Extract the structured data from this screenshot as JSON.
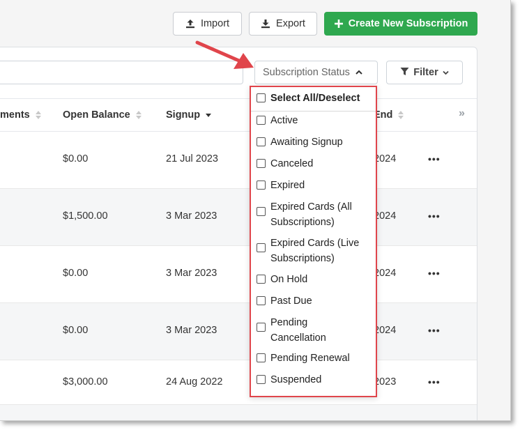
{
  "toolbar": {
    "import_label": "Import",
    "export_label": "Export",
    "create_label": "Create New Subscription"
  },
  "filters": {
    "search_value": "",
    "status_label": "Subscription Status",
    "filter_label": "Filter"
  },
  "table": {
    "columns": [
      {
        "label": "ments"
      },
      {
        "label": "Open Balance"
      },
      {
        "label": "Signup"
      },
      {
        "label": "End"
      }
    ],
    "rows": [
      {
        "open_balance": "$0.00",
        "signup": "21 Jul 2023",
        "end": "2024",
        "more": "•••"
      },
      {
        "open_balance": "$1,500.00",
        "signup": "3 Mar 2023",
        "end": "2024",
        "more": "•••"
      },
      {
        "open_balance": "$0.00",
        "signup": "3 Mar 2023",
        "end": "2024",
        "more": "•••"
      },
      {
        "open_balance": "$0.00",
        "signup": "3 Mar 2023",
        "end": "2024",
        "more": "•••"
      },
      {
        "open_balance": "$3,000.00",
        "signup": "24 Aug 2022",
        "end": "2023",
        "more": "•••"
      }
    ],
    "expand_glyph": "»"
  },
  "dropdown": {
    "select_all": "Select All/Deselect",
    "options": [
      {
        "line1": "Active",
        "line2": ""
      },
      {
        "line1": "Awaiting Signup",
        "line2": ""
      },
      {
        "line1": "Canceled",
        "line2": ""
      },
      {
        "line1": "Expired",
        "line2": ""
      },
      {
        "line1": "Expired Cards (All",
        "line2": "Subscriptions)"
      },
      {
        "line1": "Expired Cards (Live",
        "line2": "Subscriptions)"
      },
      {
        "line1": "On Hold",
        "line2": ""
      },
      {
        "line1": "Past Due",
        "line2": ""
      },
      {
        "line1": "Pending",
        "line2": "Cancellation"
      },
      {
        "line1": "Pending Renewal",
        "line2": ""
      },
      {
        "line1": "Suspended",
        "line2": ""
      }
    ]
  },
  "colors": {
    "primary_green": "#2fa84f",
    "annotation_red": "#e0454b"
  }
}
